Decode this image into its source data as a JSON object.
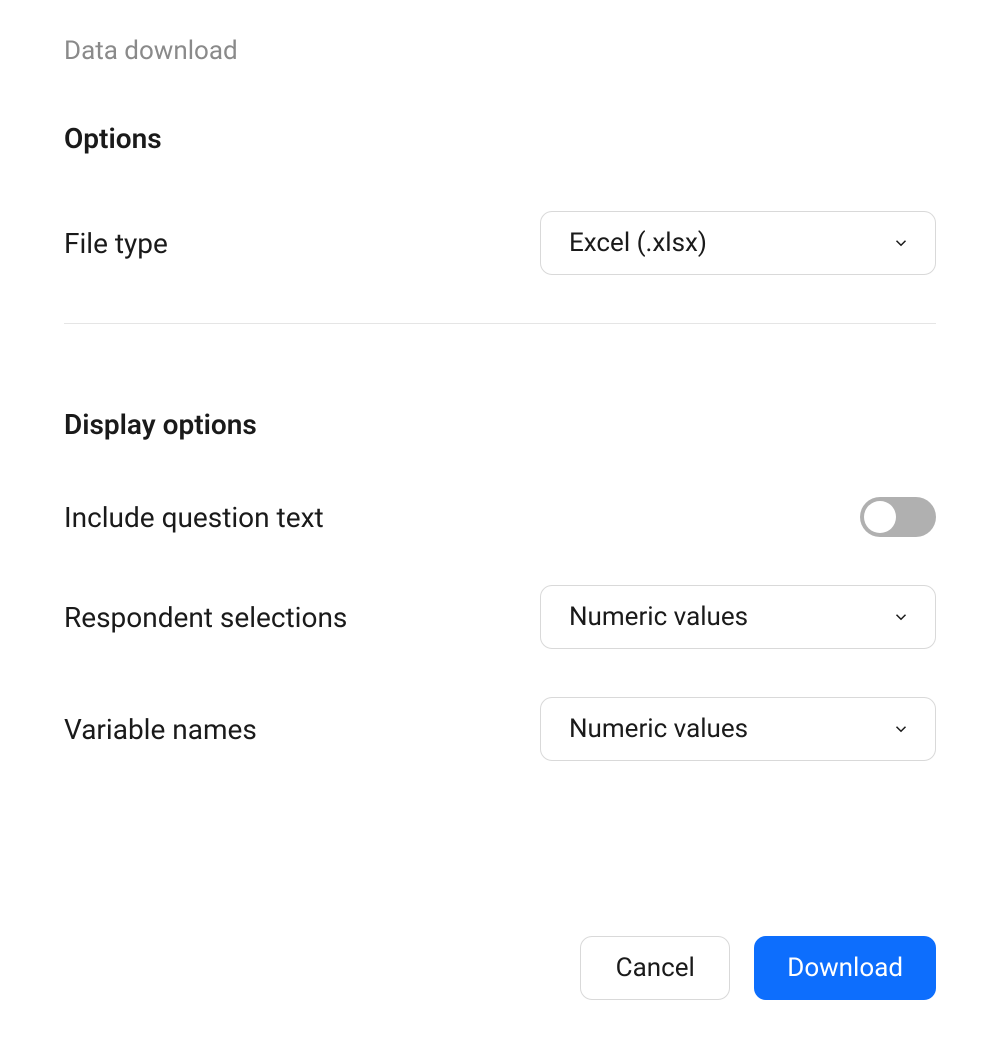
{
  "header": {
    "breadcrumb": "Data download"
  },
  "sections": {
    "options": {
      "title": "Options",
      "fileType": {
        "label": "File type",
        "value": "Excel (.xlsx)"
      }
    },
    "display": {
      "title": "Display options",
      "includeQuestionText": {
        "label": "Include question text",
        "enabled": false
      },
      "respondentSelections": {
        "label": "Respondent selections",
        "value": "Numeric values"
      },
      "variableNames": {
        "label": "Variable names",
        "value": "Numeric values"
      }
    }
  },
  "footer": {
    "cancel": "Cancel",
    "download": "Download"
  },
  "colors": {
    "primary": "#0d6efd",
    "border": "#d9d9d9",
    "muted": "#8a8a8a",
    "toggleOff": "#b0b0b0"
  }
}
